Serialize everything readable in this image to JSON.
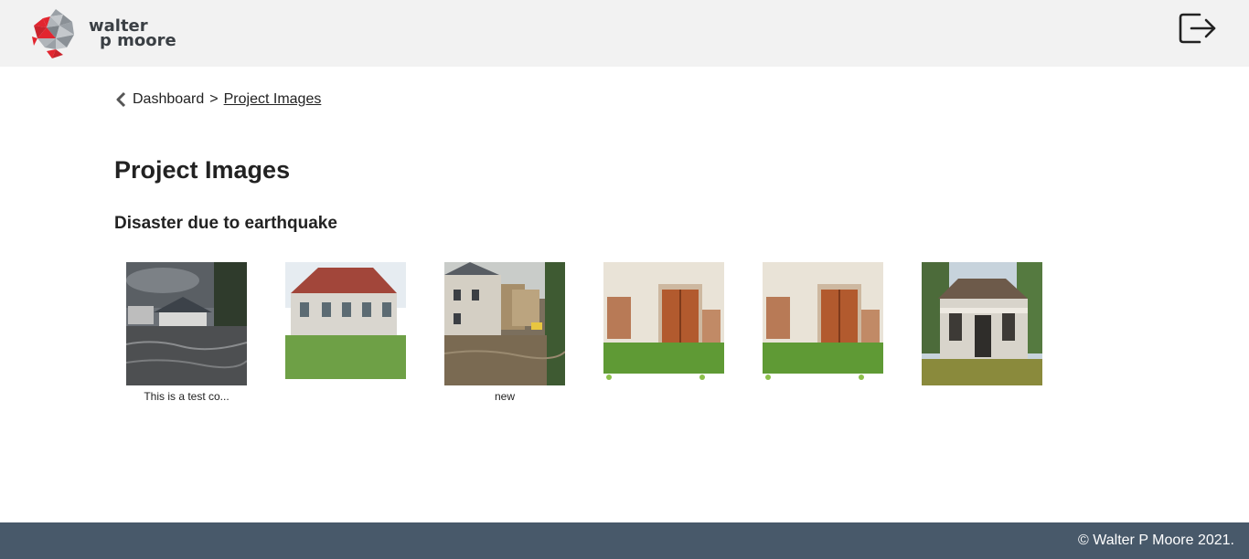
{
  "header": {
    "logo_line1": "walter",
    "logo_line2": "p moore",
    "logout_icon": "logout-icon"
  },
  "breadcrumb": {
    "back_icon": "chevron-left-icon",
    "home": "Dashboard",
    "separator": ">",
    "current": "Project Images"
  },
  "page": {
    "title": "Project Images",
    "section_title": "Disaster due to earthquake"
  },
  "gallery": {
    "images": [
      {
        "caption": "This is a test co...",
        "scene": "flooded-house"
      },
      {
        "caption": "",
        "scene": "old-house-red-roof"
      },
      {
        "caption": "new",
        "scene": "flooded-street"
      },
      {
        "caption": "",
        "scene": "brick-wall-door"
      },
      {
        "caption": "",
        "scene": "brick-wall-door"
      },
      {
        "caption": "",
        "scene": "abandoned-house"
      }
    ]
  },
  "footer": {
    "copyright": "© Walter P Moore 2021."
  },
  "colors": {
    "topbar": "#f2f2f2",
    "footer": "#48596a",
    "brand_red": "#e2252f",
    "brand_gray": "#9aa0a6"
  }
}
